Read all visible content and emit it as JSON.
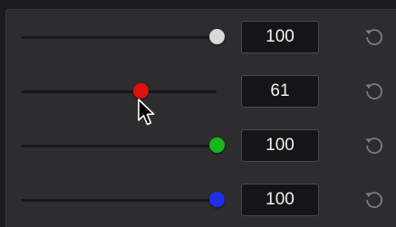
{
  "sliders": [
    {
      "value": "100",
      "fraction": 1.0,
      "knob_color": "#d9d9d9"
    },
    {
      "value": "61",
      "fraction": 0.61,
      "knob_color": "#e01010"
    },
    {
      "value": "100",
      "fraction": 1.0,
      "knob_color": "#18b51b"
    },
    {
      "value": "100",
      "fraction": 1.0,
      "knob_color": "#1f2fe6"
    }
  ],
  "icons": {
    "reset": "reset-icon",
    "cursor": "mouse-pointer-icon"
  },
  "colors": {
    "panel": "#2d2d30",
    "field": "#151517",
    "text": "#f2f2f2",
    "track": "#18181a"
  }
}
